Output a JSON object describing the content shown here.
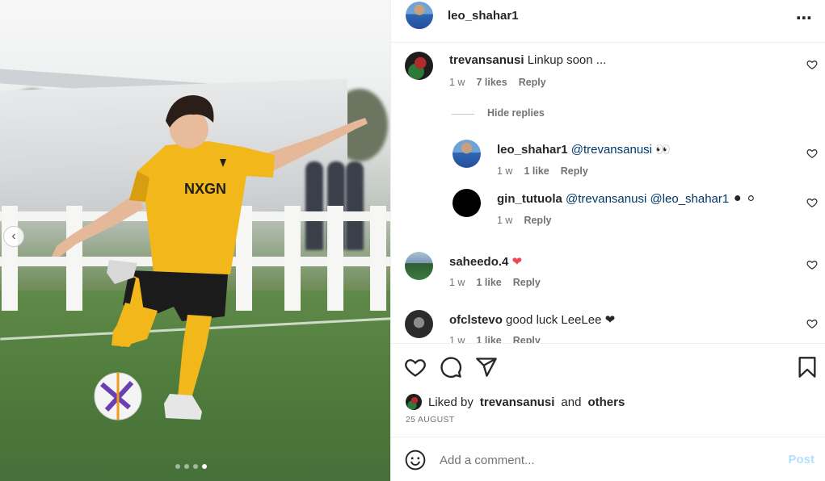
{
  "post": {
    "author": "leo_shahar1",
    "more_icon": "⋯",
    "carousel": {
      "prev_icon": "‹",
      "slide_count": 4,
      "active_index": 3
    }
  },
  "comments": [
    {
      "username": "trevansanusi",
      "text": "Linkup soon ...",
      "time": "1 w",
      "likes": "7 likes",
      "reply": "Reply"
    },
    {
      "username": "saheedo.4",
      "text": "❤",
      "time": "1 w",
      "likes": "1 like",
      "reply": "Reply"
    },
    {
      "username": "ofclstevo",
      "text": "good luck LeeLee ❤",
      "time": "1 w",
      "likes": "1 like",
      "reply": "Reply"
    }
  ],
  "hide_replies": "Hide replies",
  "replies": [
    {
      "username": "leo_shahar1",
      "mention": "@trevansanusi",
      "text": "👀",
      "time": "1 w",
      "likes": "1 like",
      "reply": "Reply"
    },
    {
      "username": "gin_tutuola",
      "mention": "@trevansanusi @leo_shahar1",
      "text": "⚫ ⚪",
      "time": "1 w",
      "reply": "Reply"
    }
  ],
  "liked_by": {
    "prefix": "Liked by",
    "user": "trevansanusi",
    "and": "and",
    "others": "others"
  },
  "date": "25 AUGUST",
  "add_comment": {
    "placeholder": "Add a comment...",
    "post_label": "Post"
  },
  "colors": {
    "link": "#00376b",
    "muted": "#737373",
    "post_disabled": "#b2dffc",
    "heart_red": "#ed4956"
  }
}
